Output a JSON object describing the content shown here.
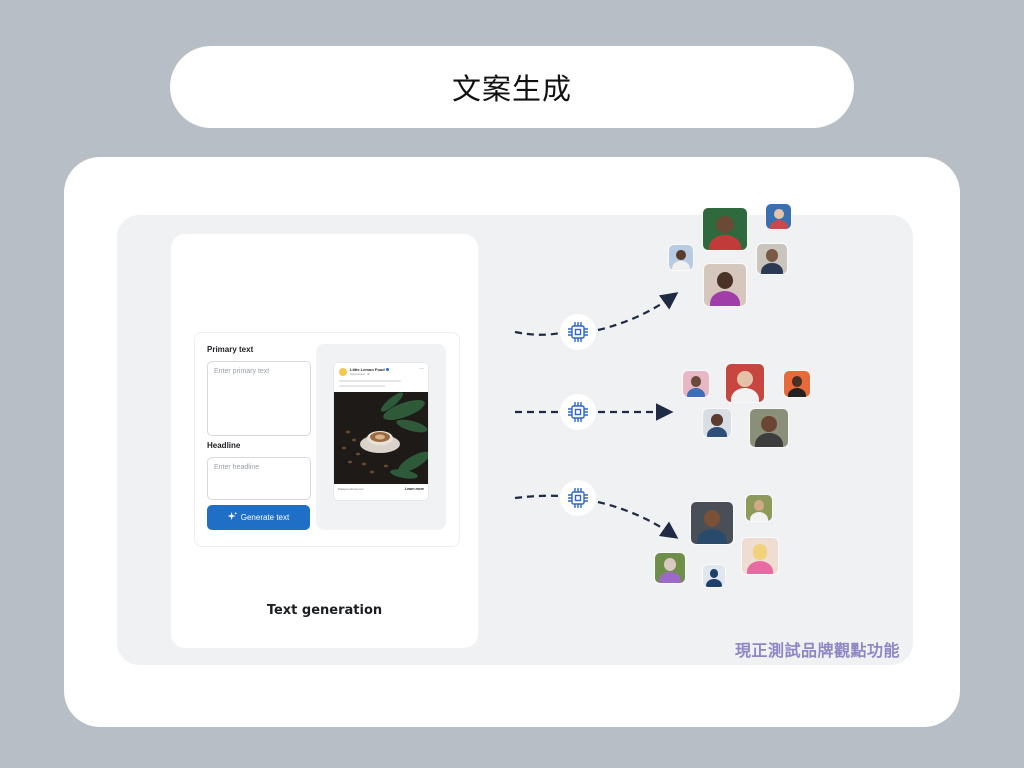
{
  "header": {
    "title": "文案生成"
  },
  "demo": {
    "primary_text_label": "Primary text",
    "primary_text_placeholder": "Enter primary text",
    "headline_label": "Headline",
    "headline_placeholder": "Enter headline",
    "generate_button_label": "Generate text",
    "caption": "Text generation"
  },
  "ad_preview": {
    "brand": "Little Lemon Food",
    "sponsored": "Sponsored · ⊕",
    "url": "littlelemonfood.com",
    "cta": "Learn more"
  },
  "footer": {
    "note": "現正測試品牌觀點功能"
  },
  "icons": [
    "sparkle-icon",
    "ai-chip-icon",
    "ellipsis-icon",
    "verified-badge-icon"
  ],
  "colors": {
    "page_bg": "#b8bec6",
    "button_blue": "#1f6fc7",
    "arrow": "#1f2a44",
    "watermark": "#8f86c4"
  }
}
